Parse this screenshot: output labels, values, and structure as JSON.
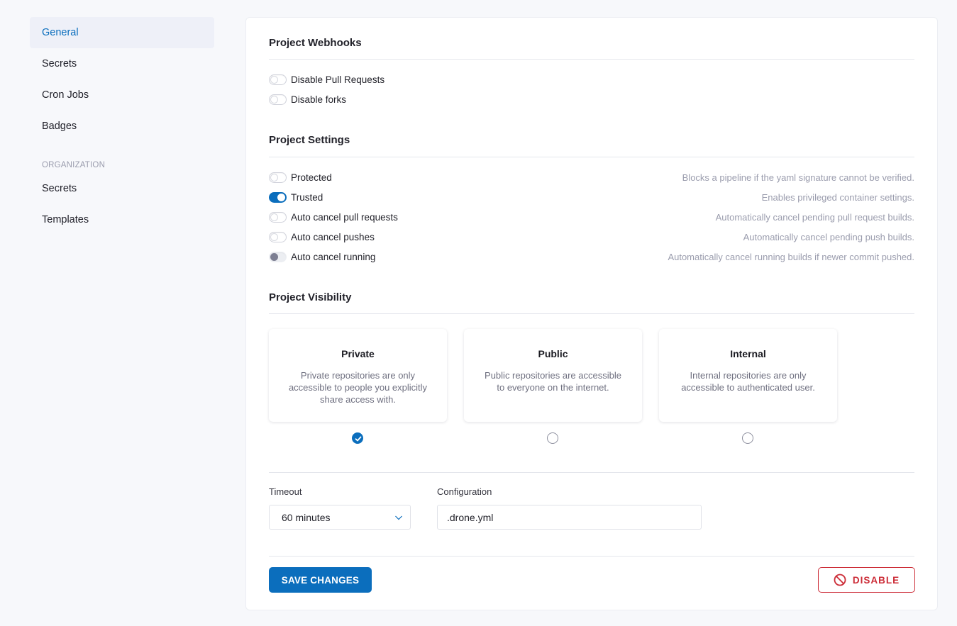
{
  "sidebar": {
    "repo_items": [
      {
        "label": "General",
        "active": true
      },
      {
        "label": "Secrets"
      },
      {
        "label": "Cron Jobs"
      },
      {
        "label": "Badges"
      }
    ],
    "org_heading": "ORGANIZATION",
    "org_items": [
      {
        "label": "Secrets"
      },
      {
        "label": "Templates"
      }
    ]
  },
  "webhooks": {
    "title": "Project Webhooks",
    "toggles": [
      {
        "label": "Disable Pull Requests",
        "state": "off"
      },
      {
        "label": "Disable forks",
        "state": "off"
      }
    ]
  },
  "settings": {
    "title": "Project Settings",
    "toggles": [
      {
        "label": "Protected",
        "state": "off",
        "description": "Blocks a pipeline if the yaml signature cannot be verified."
      },
      {
        "label": "Trusted",
        "state": "on",
        "description": "Enables privileged container settings."
      },
      {
        "label": "Auto cancel pull requests",
        "state": "off",
        "description": "Automatically cancel pending pull request builds."
      },
      {
        "label": "Auto cancel pushes",
        "state": "off",
        "description": "Automatically cancel pending push builds."
      },
      {
        "label": "Auto cancel running",
        "state": "disabled",
        "description": "Automatically cancel running builds if newer commit pushed."
      }
    ]
  },
  "visibility": {
    "title": "Project Visibility",
    "selected": "Private",
    "options": [
      {
        "title": "Private",
        "description": "Private repositories are only accessible to people you explicitly share access with.",
        "checked": true
      },
      {
        "title": "Public",
        "description": "Public repositories are accessible to everyone on the internet.",
        "checked": false
      },
      {
        "title": "Internal",
        "description": "Internal repositories are only accessible to authenticated user.",
        "checked": false
      }
    ]
  },
  "form": {
    "timeout_label": "Timeout",
    "timeout_value": "60 minutes",
    "config_label": "Configuration",
    "config_value": ".drone.yml"
  },
  "actions": {
    "save_label": "SAVE CHANGES",
    "disable_label": "DISABLE"
  },
  "colors": {
    "accent": "#0b6ebd",
    "danger": "#cc2b36",
    "muted_text": "#9a9cad"
  }
}
